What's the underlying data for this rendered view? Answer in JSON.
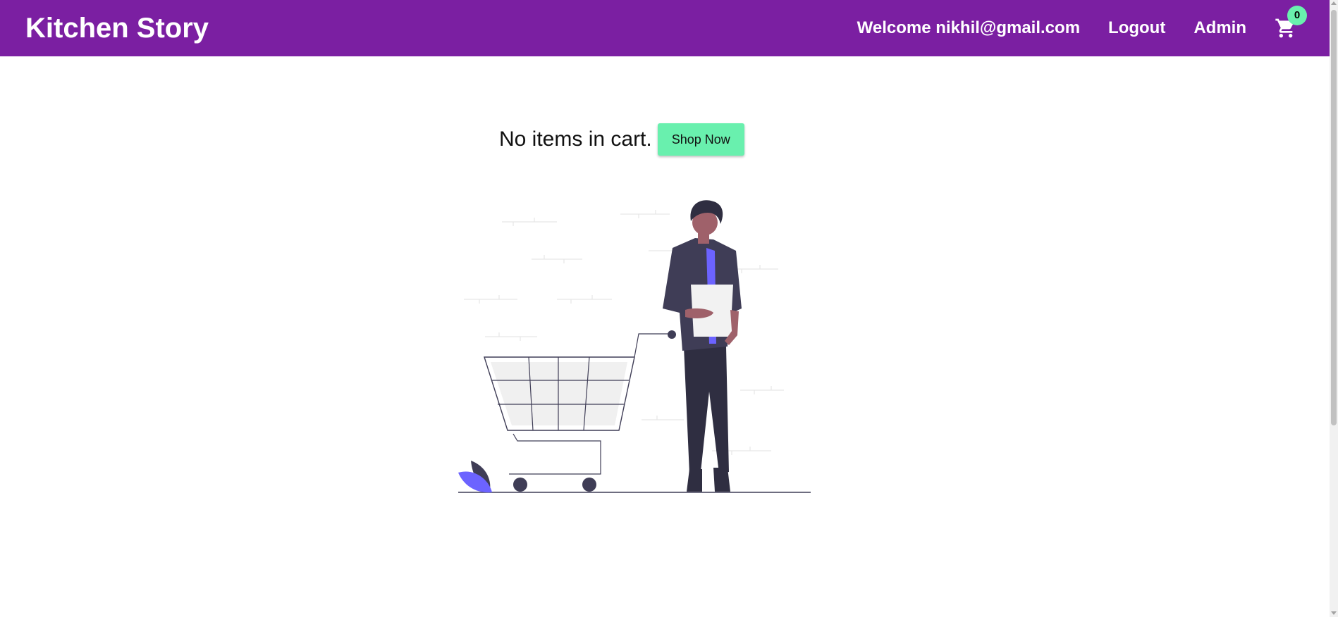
{
  "header": {
    "brand": "Kitchen Story",
    "welcome": "Welcome nikhil@gmail.com",
    "logout_label": "Logout",
    "admin_label": "Admin",
    "cart_icon": "shopping-cart-icon",
    "cart_count": "0"
  },
  "main": {
    "empty_message": "No items in cart.",
    "shop_now_label": "Shop Now",
    "illustration": "empty-cart-illustration"
  },
  "colors": {
    "navbar": "#7b1fa2",
    "accent": "#69f0ae",
    "illustration_dark": "#3f3d56",
    "illustration_purple": "#6c63ff"
  }
}
